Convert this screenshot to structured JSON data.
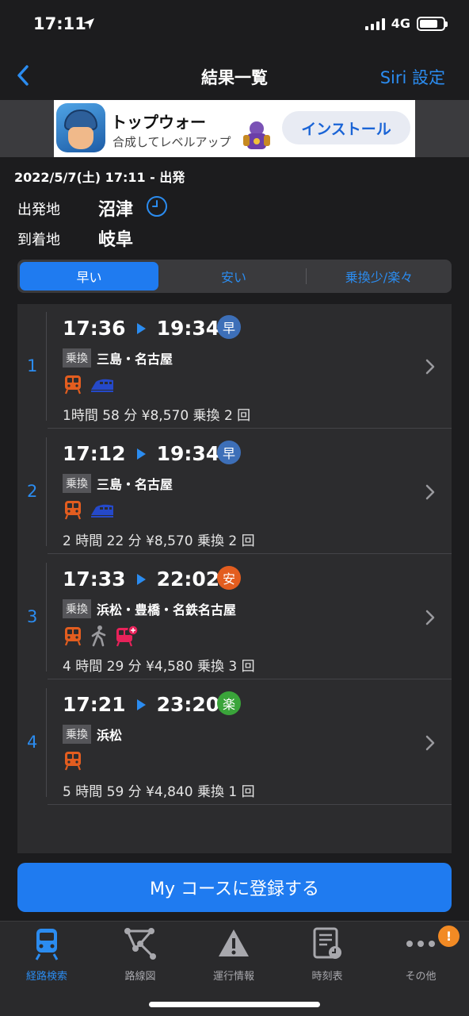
{
  "status": {
    "time": "17:11",
    "network": "4G",
    "battery_level": 0.8
  },
  "nav": {
    "title": "結果一覧",
    "right_action": "Siri 設定"
  },
  "ad": {
    "title": "トップウォー",
    "subtitle": "合成してレベルアップ",
    "install_label": "インストール"
  },
  "search": {
    "datetime": "2022/5/7(土) 17:11 - 出発",
    "from_label": "出発地",
    "from_value": "沼津",
    "to_label": "到着地",
    "to_value": "岐阜"
  },
  "tabs": [
    {
      "label": "早い"
    },
    {
      "label": "安い"
    },
    {
      "label": "乗換少/楽々"
    }
  ],
  "routes": [
    {
      "index": "1",
      "depart": "17:36",
      "arrive": "19:34",
      "badge": "早",
      "badge_color": "#3d6fb8",
      "transfer_tag": "乗換",
      "stations": "三島・名古屋",
      "icons": [
        "train-icon",
        "shinkansen-icon"
      ],
      "summary": "1時間 58 分  ¥8,570  乗換 2 回"
    },
    {
      "index": "2",
      "depart": "17:12",
      "arrive": "19:34",
      "badge": "早",
      "badge_color": "#3d6fb8",
      "transfer_tag": "乗換",
      "stations": "三島・名古屋",
      "icons": [
        "train-icon",
        "shinkansen-icon"
      ],
      "summary": "2 時間 22 分  ¥8,570  乗換 2 回"
    },
    {
      "index": "3",
      "depart": "17:33",
      "arrive": "22:02",
      "badge": "安",
      "badge_color": "#e35d1f",
      "transfer_tag": "乗換",
      "stations": "浜松・豊橋・名鉄名古屋",
      "icons": [
        "train-icon",
        "walk-icon",
        "private-railway-icon"
      ],
      "summary": "4 時間 29 分  ¥4,580  乗換 3 回"
    },
    {
      "index": "4",
      "depart": "17:21",
      "arrive": "23:20",
      "badge": "楽",
      "badge_color": "#3aa43a",
      "transfer_tag": "乗換",
      "stations": "浜松",
      "icons": [
        "train-icon"
      ],
      "summary": "5 時間 59 分  ¥4,840  乗換 1 回"
    }
  ],
  "register_label": "My コースに登録する",
  "tabbar": [
    {
      "label": "経路検索",
      "icon": "train-front-icon"
    },
    {
      "label": "路線図",
      "icon": "route-map-icon"
    },
    {
      "label": "運行情報",
      "icon": "warning-icon"
    },
    {
      "label": "時刻表",
      "icon": "timetable-icon"
    },
    {
      "label": "その他",
      "icon": "more-icon"
    }
  ],
  "notification_badge": "!"
}
